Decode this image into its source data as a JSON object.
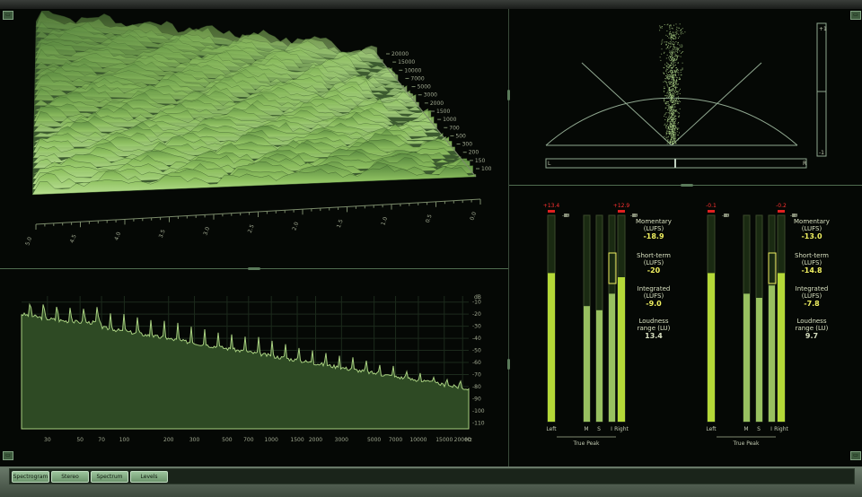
{
  "spectrogram": {
    "freq_labels": [
      "20000",
      "15000",
      "10000",
      "7000",
      "5000",
      "3000",
      "2000",
      "1500",
      "1000",
      "700",
      "500",
      "300",
      "200",
      "150",
      "100"
    ],
    "time_labels": [
      "5.0",
      "4.5",
      "4.0",
      "3.5",
      "3.0",
      "2.5",
      "2.0",
      "1.5",
      "1.0",
      "0.5",
      "0.0"
    ]
  },
  "spectrum": {
    "unit_db": "dB",
    "db_labels": [
      "-10",
      "-20",
      "-30",
      "-40",
      "-50",
      "-60",
      "-70",
      "-80",
      "-90",
      "-100",
      "-110"
    ],
    "hz_labels": [
      "30",
      "50",
      "70",
      "100",
      "200",
      "300",
      "500",
      "700",
      "1000",
      "1500",
      "2000",
      "3000",
      "5000",
      "7000",
      "10000",
      "15000",
      "20000"
    ],
    "hz_unit": "Hz"
  },
  "stereo": {
    "left_label": "L",
    "right_label": "R",
    "scale_top": "+1",
    "scale_bottom": "-1"
  },
  "levels": {
    "groups": [
      {
        "peak_left": "+13.4",
        "peak_right": "+12.9",
        "scale": [
          "0",
          "-3",
          "-6",
          "-10",
          "-15",
          "-20",
          "-30",
          "-40",
          "-50",
          "-inf"
        ],
        "bottom_labels": {
          "left": "Left",
          "m": "M",
          "s": "S",
          "i": "I",
          "right": "Right",
          "true_peak": "True Peak"
        },
        "momentary_label": "Momentary\n(LUFS)",
        "momentary": "-18.9",
        "shortterm_label": "Short-term\n(LUFS)",
        "shortterm": "-20",
        "integrated_label": "Integrated\n(LUFS)",
        "integrated": "-9.0",
        "range_label": "Loudness\nrange (LU)",
        "range": "13.4"
      },
      {
        "peak_left": "-0.1",
        "peak_right": "-0.2",
        "scale": [
          "0",
          "-3",
          "-6",
          "-10",
          "-15",
          "-20",
          "-30",
          "-40",
          "-50",
          "-inf"
        ],
        "bottom_labels": {
          "left": "Left",
          "m": "M",
          "s": "S",
          "i": "I",
          "right": "Right",
          "true_peak": "True Peak"
        },
        "momentary_label": "Momentary\n(LUFS)",
        "momentary": "-13.0",
        "shortterm_label": "Short-term\n(LUFS)",
        "shortterm": "-14.8",
        "integrated_label": "Integrated\n(LUFS)",
        "integrated": "-7.8",
        "range_label": "Loudness\nrange (LU)",
        "range": "9.7"
      }
    ]
  },
  "tabs": [
    "Spectrogram",
    "Stereo",
    "Spectrum",
    "Levels"
  ],
  "colors": {
    "accent": "#a8d080",
    "meter": "#b4d838",
    "peak": "#e02020",
    "value": "#f0f060"
  }
}
